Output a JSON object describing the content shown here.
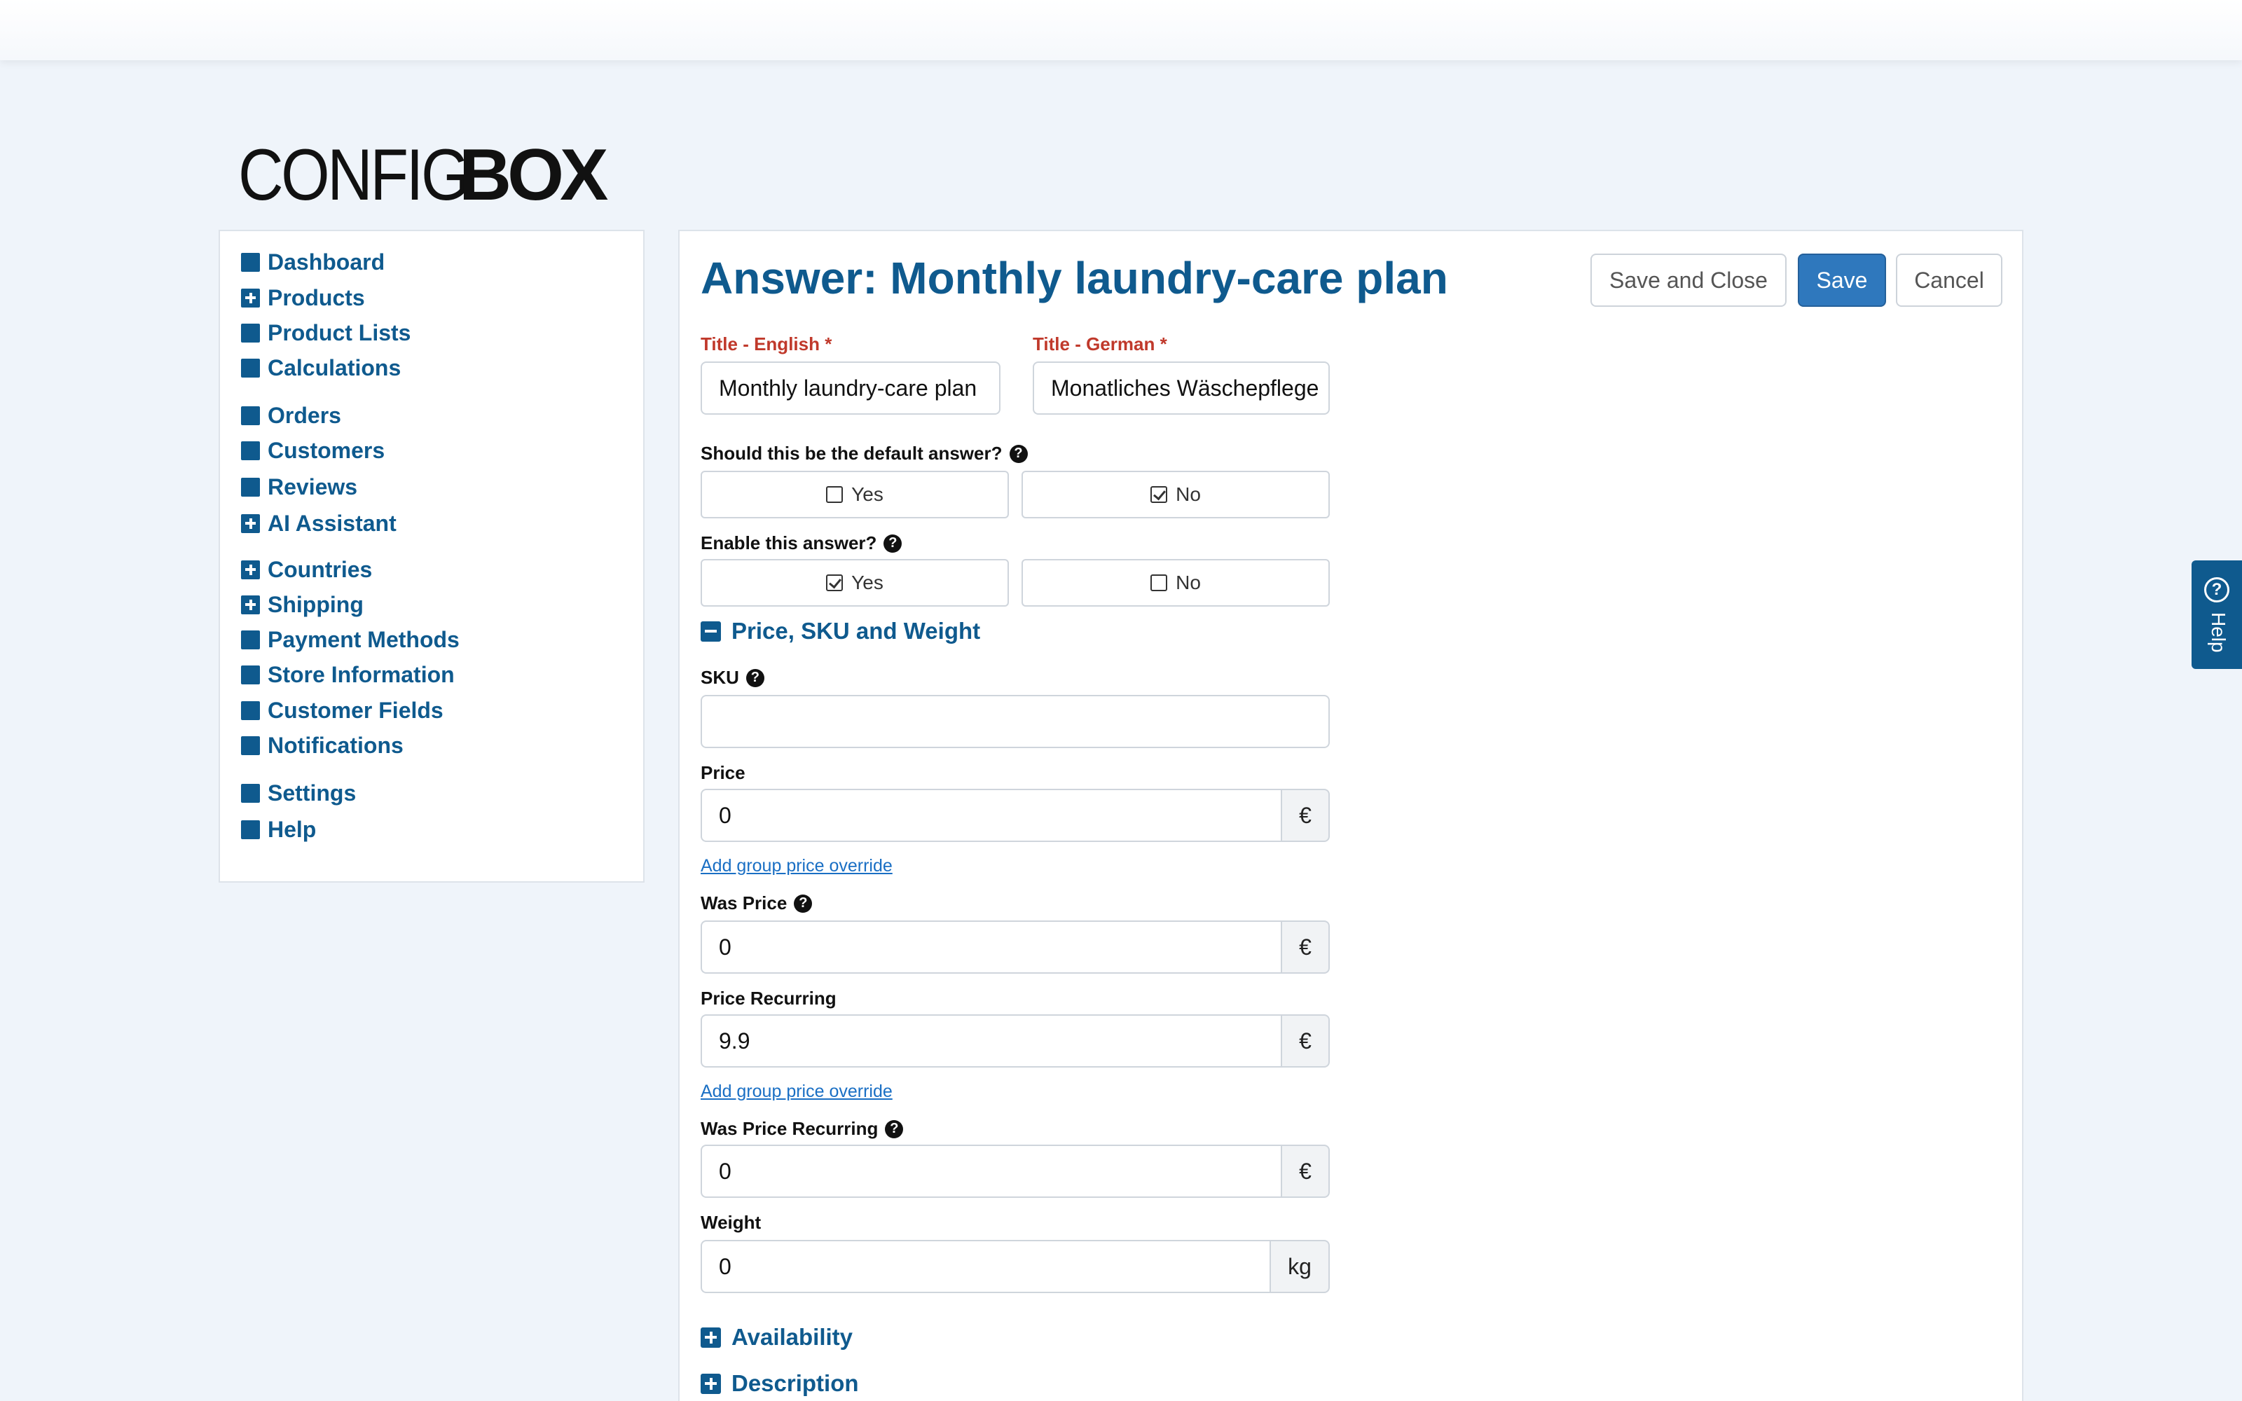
{
  "logo": {
    "thin": "CONFIG",
    "bold": "BOX"
  },
  "sidebar": {
    "items": [
      {
        "label": "Dashboard",
        "icon": "square-icon"
      },
      {
        "label": "Products",
        "icon": "plus-square-icon"
      },
      {
        "label": "Product Lists",
        "icon": "square-icon"
      },
      {
        "label": "Calculations",
        "icon": "square-icon"
      },
      {
        "label": "Orders",
        "icon": "square-icon"
      },
      {
        "label": "Customers",
        "icon": "square-icon"
      },
      {
        "label": "Reviews",
        "icon": "square-icon"
      },
      {
        "label": "AI Assistant",
        "icon": "plus-square-icon"
      },
      {
        "label": "Countries",
        "icon": "plus-square-icon"
      },
      {
        "label": "Shipping",
        "icon": "plus-square-icon"
      },
      {
        "label": "Payment Methods",
        "icon": "square-icon"
      },
      {
        "label": "Store Information",
        "icon": "square-icon"
      },
      {
        "label": "Customer Fields",
        "icon": "square-icon"
      },
      {
        "label": "Notifications",
        "icon": "square-icon"
      },
      {
        "label": "Settings",
        "icon": "square-icon"
      },
      {
        "label": "Help",
        "icon": "square-icon"
      }
    ]
  },
  "main": {
    "title": "Answer: Monthly laundry-care plan",
    "buttons": {
      "save_close": "Save and Close",
      "save": "Save",
      "cancel": "Cancel"
    },
    "title_en": {
      "label": "Title - English *",
      "value": "Monthly laundry-care plan"
    },
    "title_de": {
      "label": "Title - German *",
      "value": "Monatliches Wäschepflege"
    },
    "default_answer": {
      "label": "Should this be the default answer?",
      "yes": "Yes",
      "no": "No",
      "selected": "No"
    },
    "enable_answer": {
      "label": "Enable this answer?",
      "yes": "Yes",
      "no": "No",
      "selected": "Yes"
    },
    "section_price": "Price, SKU and Weight",
    "sku": {
      "label": "SKU",
      "value": ""
    },
    "price": {
      "label": "Price",
      "value": "0",
      "unit": "€"
    },
    "add_override_1": "Add group price override",
    "was_price": {
      "label": "Was Price",
      "value": "0",
      "unit": "€"
    },
    "price_recurring": {
      "label": "Price Recurring",
      "value": "9.9",
      "unit": "€"
    },
    "add_override_2": "Add group price override",
    "was_price_recurring": {
      "label": "Was Price Recurring",
      "value": "0",
      "unit": "€"
    },
    "weight": {
      "label": "Weight",
      "value": "0",
      "unit": "kg"
    },
    "section_availability": "Availability",
    "section_description": "Description"
  },
  "help_tab": {
    "label": "Help",
    "glyph": "?"
  },
  "help_glyph": "?",
  "colors": {
    "brand": "#0f5a8e",
    "primary_button": "#2f78bd",
    "required": "#c0392b",
    "background": "#eff4fa"
  }
}
